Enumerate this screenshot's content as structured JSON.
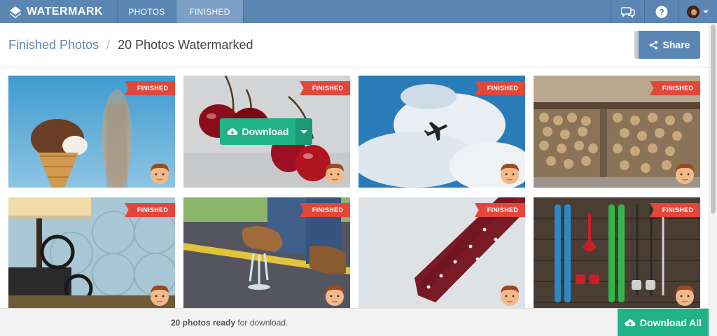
{
  "nav": {
    "brand": "WATERMARK",
    "tabs": [
      {
        "label": "PHOTOS",
        "active": false
      },
      {
        "label": "FINISHED",
        "active": true
      }
    ],
    "icons": [
      "chat-icon",
      "help-icon",
      "avatar"
    ]
  },
  "breadcrumb": {
    "parent": "Finished Photos",
    "separator": "/",
    "current": "20 Photos Watermarked"
  },
  "share_label": "Share",
  "photos": [
    {
      "subject": "ice cream cone",
      "badge": "FINISHED"
    },
    {
      "subject": "cherries",
      "badge": "FINISHED",
      "hover_action": "Download"
    },
    {
      "subject": "airplane in clouds",
      "badge": "FINISHED"
    },
    {
      "subject": "stacked firewood",
      "badge": "FINISHED"
    },
    {
      "subject": "film projector and lamp",
      "badge": "FINISHED"
    },
    {
      "subject": "boot stepping in puddle",
      "badge": "FINISHED"
    },
    {
      "subject": "red necktie",
      "badge": "FINISHED"
    },
    {
      "subject": "skis on wooden floor",
      "badge": "FINISHED"
    }
  ],
  "footer": {
    "count_text": "20 photos ready",
    "suffix_text": " for download.",
    "download_all_label": "Download All"
  },
  "colors": {
    "nav": "#5b86b3",
    "accent_green": "#20b387",
    "ribbon_red": "#e2473a"
  }
}
